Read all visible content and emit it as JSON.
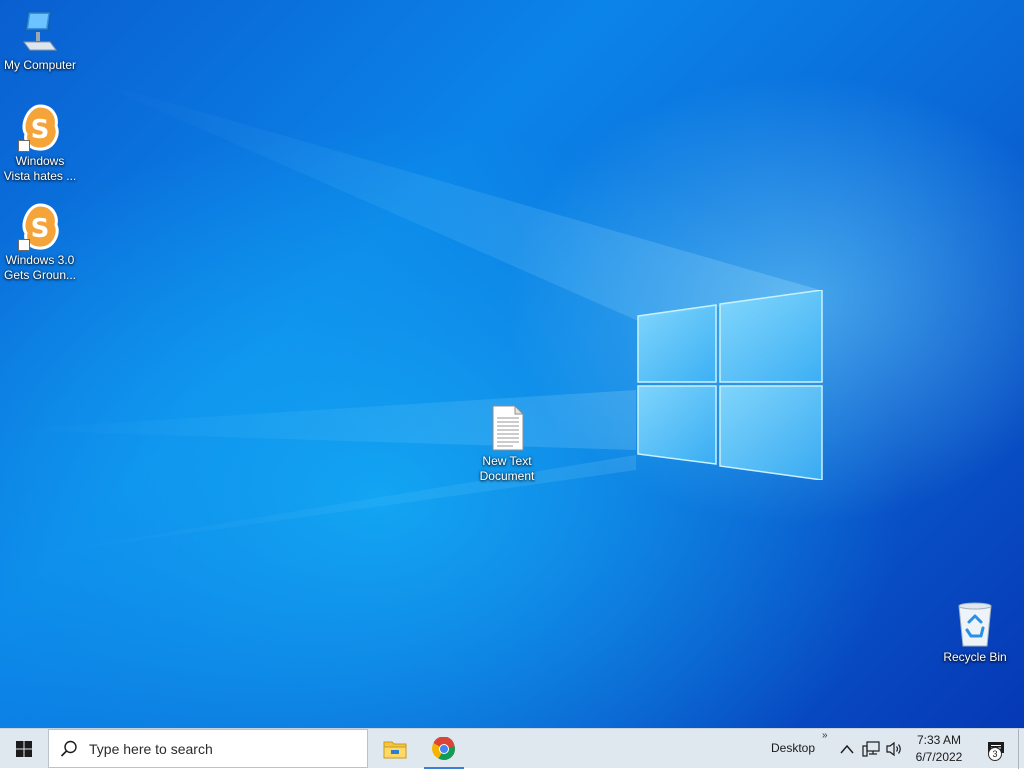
{
  "desktop": {
    "icons": [
      {
        "label": "My Computer"
      },
      {
        "label": "Windows\nVista hates ..."
      },
      {
        "label": "Windows 3.0\nGets Groun..."
      },
      {
        "label": "New Text\nDocument"
      },
      {
        "label": "Recycle Bin"
      }
    ]
  },
  "taskbar": {
    "search_placeholder": "Type here to search",
    "apps": [
      "file-explorer",
      "chrome"
    ],
    "toolbar_label": "Desktop",
    "toolbar_chevron": "»",
    "clock": {
      "time": "7:33 AM",
      "date": "6/7/2022"
    },
    "notification_count": "3"
  },
  "colors": {
    "taskbar_bg": "#dfe7ef",
    "accent": "#3b7fd6",
    "icon_orange": "#f5a43a"
  }
}
